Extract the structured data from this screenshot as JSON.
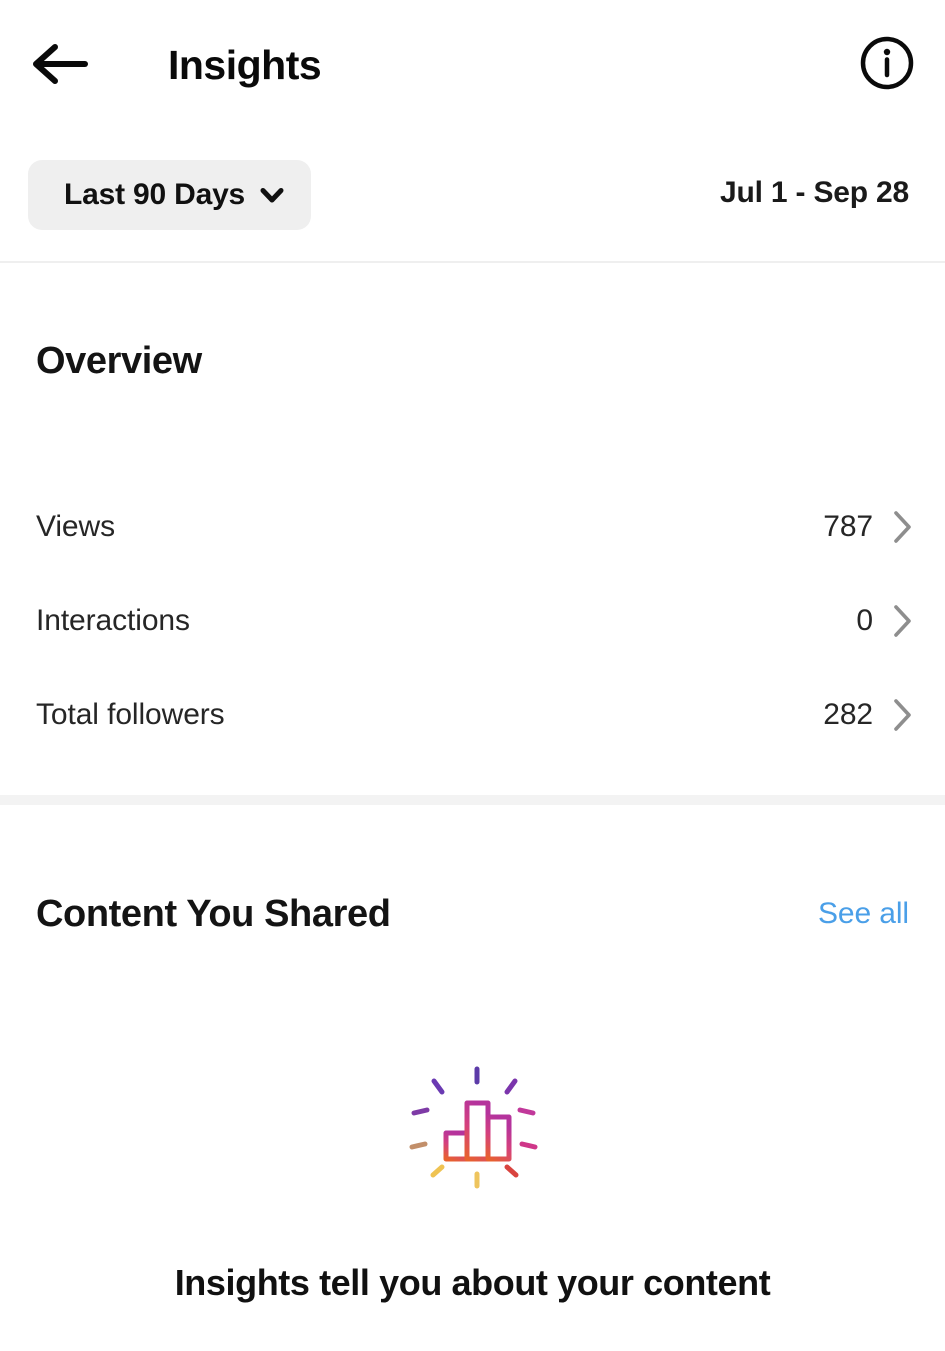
{
  "header": {
    "title": "Insights",
    "back_icon": "arrow-left-icon",
    "info_icon": "info-circle-icon"
  },
  "filter": {
    "range_label": "Last 90 Days",
    "chevron_icon": "chevron-down-icon",
    "date_range": "Jul 1 - Sep 28"
  },
  "overview": {
    "title": "Overview",
    "metrics": [
      {
        "label": "Views",
        "value": "787",
        "chevron_icon": "chevron-right-icon"
      },
      {
        "label": "Interactions",
        "value": "0",
        "chevron_icon": "chevron-right-icon"
      },
      {
        "label": "Total followers",
        "value": "282",
        "chevron_icon": "chevron-right-icon"
      }
    ]
  },
  "content_shared": {
    "title": "Content You Shared",
    "see_all_label": "See all",
    "empty_state": {
      "illustration_icon": "bar-chart-burst-icon",
      "message": "Insights tell you about your content"
    }
  },
  "colors": {
    "link_blue": "#4a9fe8",
    "pill_gray": "#efefef",
    "band_gray": "#f3f3f3",
    "text_dark": "#262626",
    "illustration_purple": "#6a3ab2",
    "illustration_magenta": "#c9338a",
    "illustration_orange": "#e8622c",
    "illustration_yellow": "#efc352"
  }
}
